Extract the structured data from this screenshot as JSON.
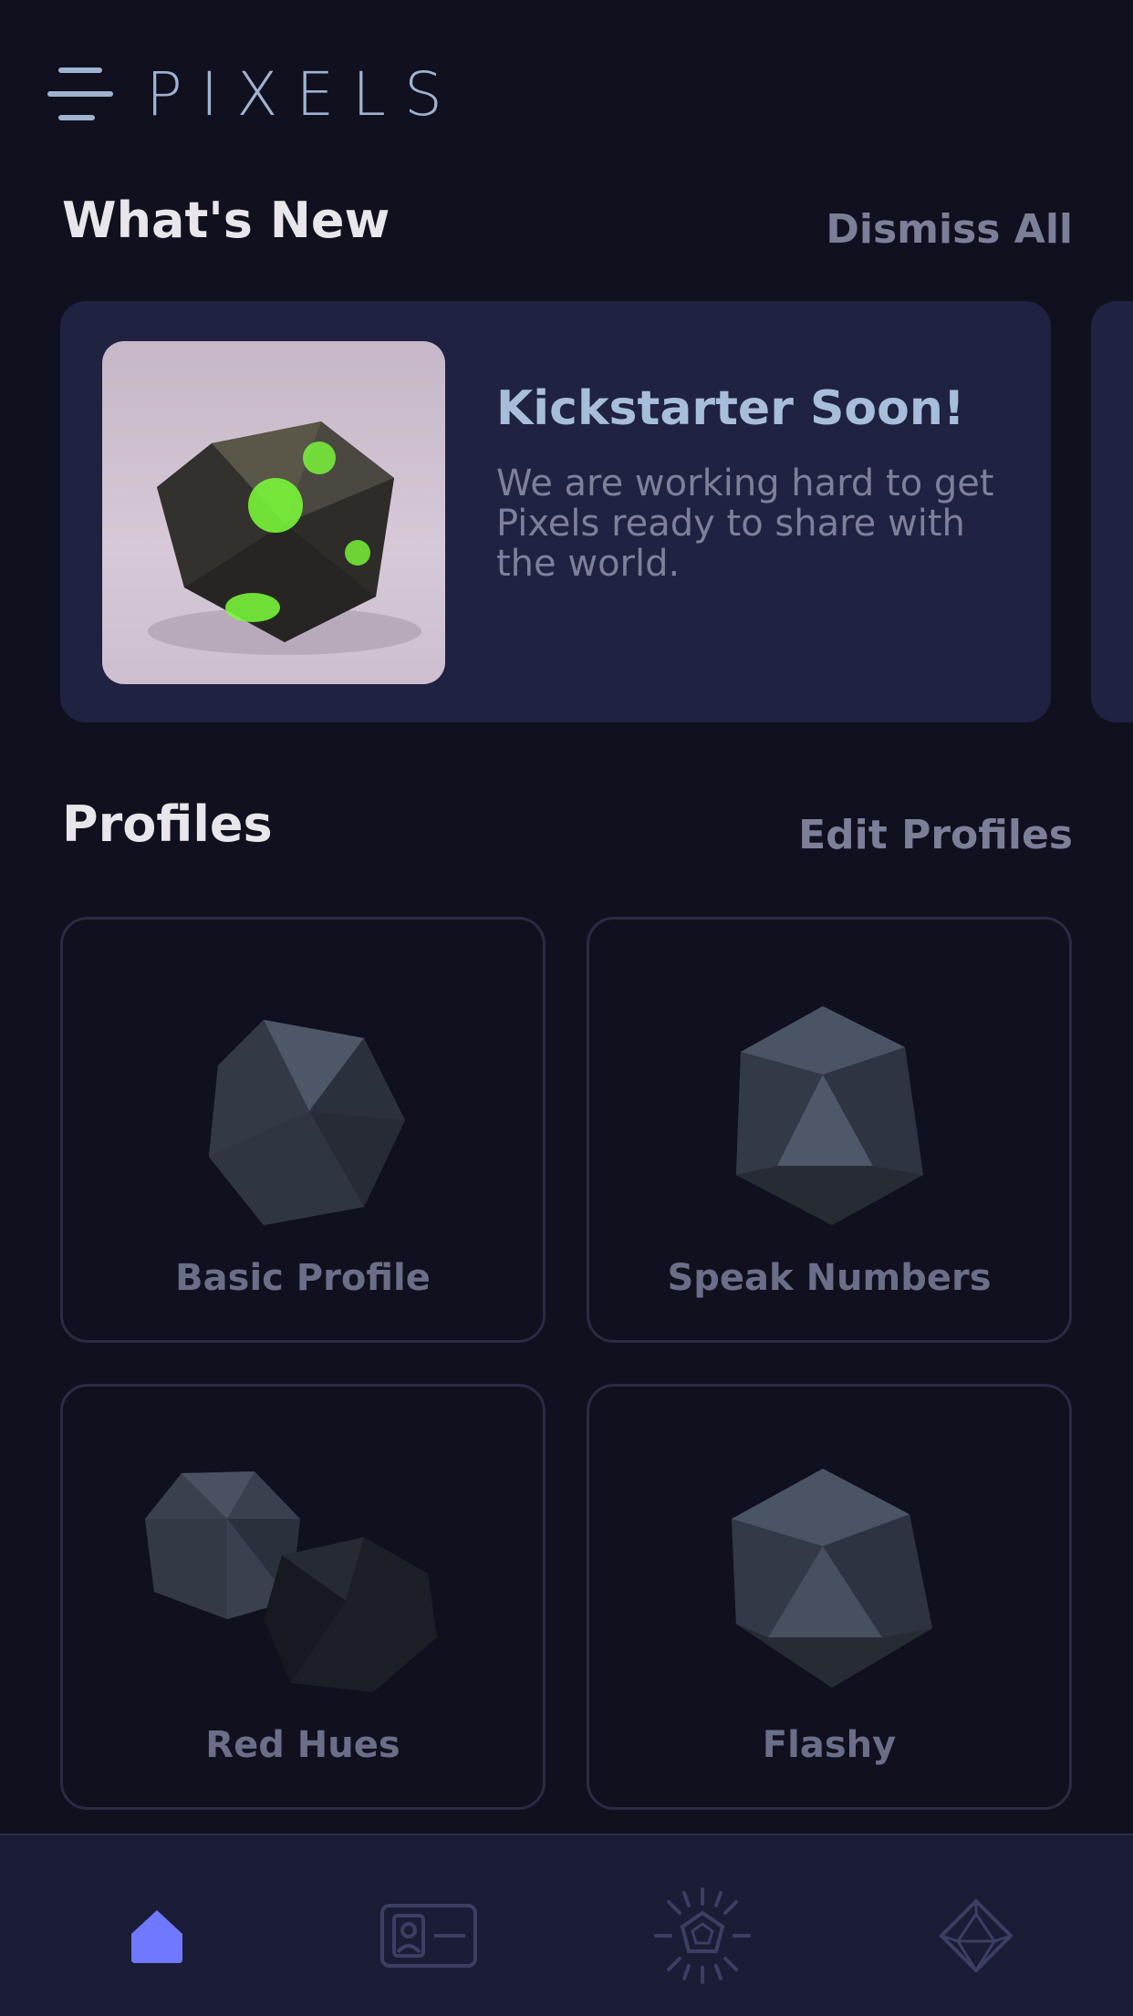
{
  "app": {
    "brand": "PIXELS"
  },
  "whats_new": {
    "title": "What's New",
    "dismiss_label": "Dismiss All",
    "card": {
      "title": "Kickstarter Soon!",
      "body": "We are working hard to get Pixels ready to share with the world."
    }
  },
  "profiles": {
    "title": "Profiles",
    "edit_label": "Edit Profiles",
    "items": [
      {
        "label": "Basic Profile"
      },
      {
        "label": "Speak Numbers"
      },
      {
        "label": "Red Hues"
      },
      {
        "label": "Flashy"
      }
    ]
  },
  "nav": {
    "items": [
      {
        "icon": "home-icon",
        "active": true
      },
      {
        "icon": "id-card-icon",
        "active": false
      },
      {
        "icon": "dice-burst-icon",
        "active": false
      },
      {
        "icon": "d20-icon",
        "active": false
      }
    ],
    "active_color": "#6f78ff",
    "inactive_color": "#3b3f63"
  }
}
